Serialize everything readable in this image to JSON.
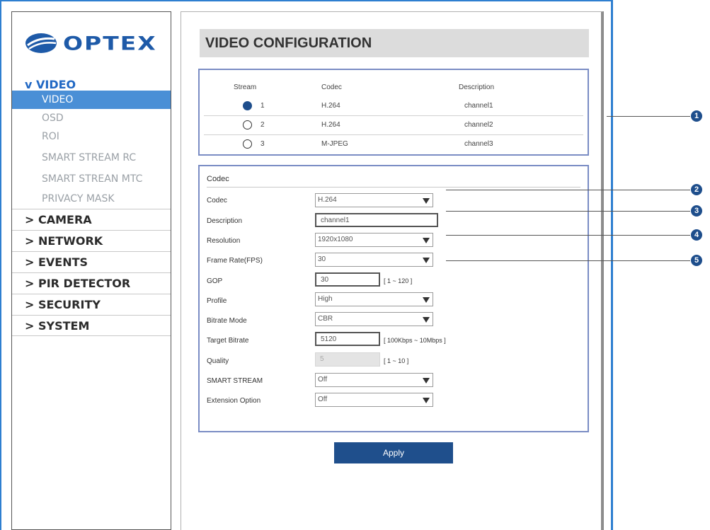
{
  "brand": {
    "name": "OPTEX"
  },
  "sidebar": {
    "open_section": "v VIDEO",
    "sub_items": [
      "VIDEO",
      "OSD",
      "ROI",
      "SMART STREAM RC",
      "SMART STREAN MTC",
      "PRIVACY MASK"
    ],
    "active_sub": "VIDEO",
    "sections": [
      "> CAMERA",
      "> NETWORK",
      "> EVENTS",
      "> PIR DETECTOR",
      "> SECURITY",
      "> SYSTEM"
    ]
  },
  "page": {
    "title": "VIDEO CONFIGURATION"
  },
  "stream_table": {
    "headers": {
      "stream": "Stream",
      "codec": "Codec",
      "description": "Description"
    },
    "rows": [
      {
        "num": "1",
        "codec": "H.264",
        "description": "channel1",
        "selected": true
      },
      {
        "num": "2",
        "codec": "H.264",
        "description": "channel2",
        "selected": false
      },
      {
        "num": "3",
        "codec": "M-JPEG",
        "description": "channel3",
        "selected": false
      }
    ]
  },
  "codec_form": {
    "section_title": "Codec",
    "codec": {
      "label": "Codec",
      "value": "H.264"
    },
    "description": {
      "label": "Description",
      "value": "channel1"
    },
    "resolution": {
      "label": "Resolution",
      "value": "1920x1080"
    },
    "frame_rate": {
      "label": "Frame Rate(FPS)",
      "value": "30"
    },
    "gop": {
      "label": "GOP",
      "value": "30",
      "hint": "[ 1 ~ 120 ]"
    },
    "profile": {
      "label": "Profile",
      "value": "High"
    },
    "bitrate_mode": {
      "label": "Bitrate Mode",
      "value": "CBR"
    },
    "target_bitrate": {
      "label": "Target Bitrate",
      "value": "5120",
      "hint": "[ 100Kbps ~ 10Mbps ]"
    },
    "quality": {
      "label": "Quality",
      "value": "5",
      "hint": "[ 1 ~ 10 ]"
    },
    "smart_stream": {
      "label": "SMART STREAM",
      "value": "Off"
    },
    "extension_option": {
      "label": "Extension Option",
      "value": "Off"
    }
  },
  "apply_label": "Apply",
  "callouts": [
    "1",
    "2",
    "3",
    "4",
    "5"
  ],
  "colors": {
    "accent": "#1f4f8c",
    "sidebar_active": "#4a8fd6",
    "frame": "#2e7fd0",
    "box_border": "#7a8cc4"
  }
}
